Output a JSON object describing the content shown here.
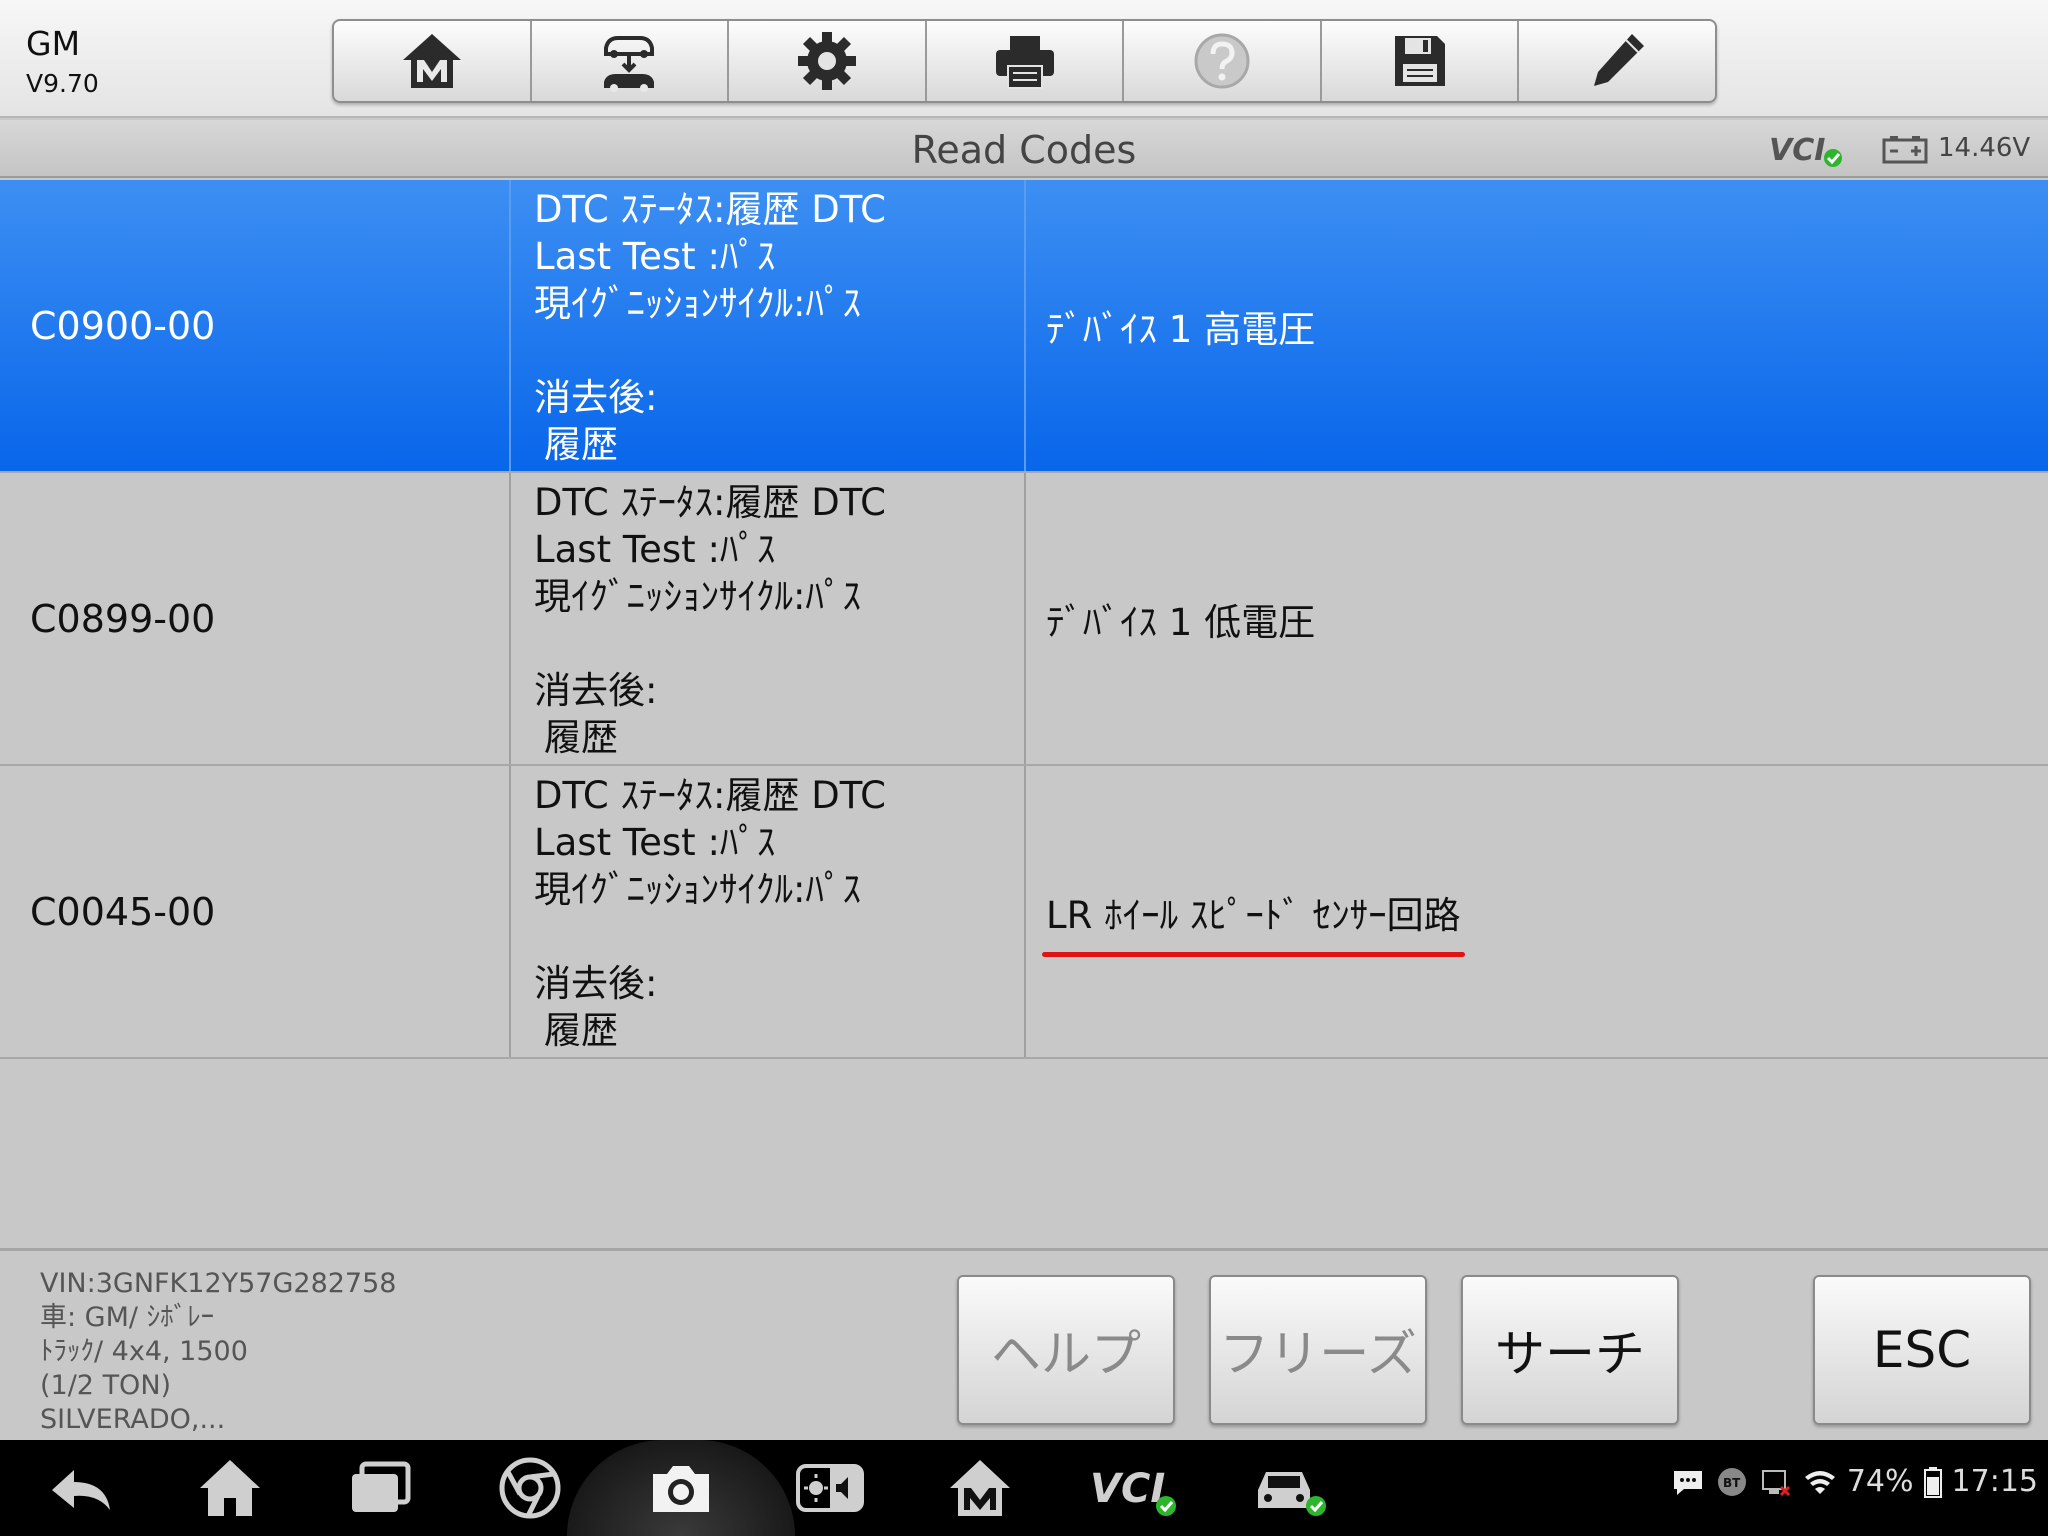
{
  "app": {
    "brand": "GM",
    "version": "V9.70"
  },
  "toolbar": {
    "buttons": [
      {
        "name": "home",
        "icon": "maxisys-home-icon"
      },
      {
        "name": "vehicle-swap",
        "icon": "vehicle-swap-icon"
      },
      {
        "name": "settings",
        "icon": "gear-icon"
      },
      {
        "name": "print",
        "icon": "printer-icon"
      },
      {
        "name": "help",
        "icon": "question-icon"
      },
      {
        "name": "save",
        "icon": "save-icon"
      },
      {
        "name": "edit",
        "icon": "pencil-icon"
      }
    ]
  },
  "header": {
    "title": "Read Codes",
    "vcl_label": "VCI",
    "voltage": "14.46V"
  },
  "codes": [
    {
      "code": "C0900-00",
      "status_lines": [
        "DTC ｽﾃｰﾀｽ:履歴 DTC",
        "Last Test :ﾊﾟｽ",
        "現ｲｸﾞﾆｯｼｮﾝｻｲｸﾙ:ﾊﾟｽ",
        "消去後:",
        "履歴"
      ],
      "description": "ﾃﾞﾊﾞｲｽ 1 高電圧",
      "selected": true
    },
    {
      "code": "C0899-00",
      "status_lines": [
        "DTC ｽﾃｰﾀｽ:履歴 DTC",
        "Last Test :ﾊﾟｽ",
        "現ｲｸﾞﾆｯｼｮﾝｻｲｸﾙ:ﾊﾟｽ",
        "消去後:",
        "履歴"
      ],
      "description": "ﾃﾞﾊﾞｲｽ 1 低電圧",
      "selected": false
    },
    {
      "code": "C0045-00",
      "status_lines": [
        "DTC ｽﾃｰﾀｽ:履歴 DTC",
        "Last Test :ﾊﾟｽ",
        "現ｲｸﾞﾆｯｼｮﾝｻｲｸﾙ:ﾊﾟｽ",
        "消去後:",
        "履歴"
      ],
      "description": "LR ﾎｲｰﾙ ｽﾋﾟｰﾄﾞ ｾﾝｻｰ回路",
      "selected": false
    }
  ],
  "footer": {
    "vehicle_lines": [
      "VIN:3GNFK12Y57G282758",
      "車: GM/ ｼﾎﾞﾚｰ",
      "ﾄﾗｯｸ/ 4x4, 1500",
      "(1/2 TON)",
      "SILVERADO,..."
    ],
    "help_label": "ヘルプ",
    "freeze_label": "フリーズ",
    "search_label": "サーチ",
    "esc_label": "ESC"
  },
  "system": {
    "battery": "74%",
    "time": "17:15",
    "bt_label": "BT",
    "vcl_label": "VCI"
  },
  "colors": {
    "selected_row": "#0866ea",
    "annotation_underline": "#e01414",
    "ok_badge": "#2db52d"
  }
}
